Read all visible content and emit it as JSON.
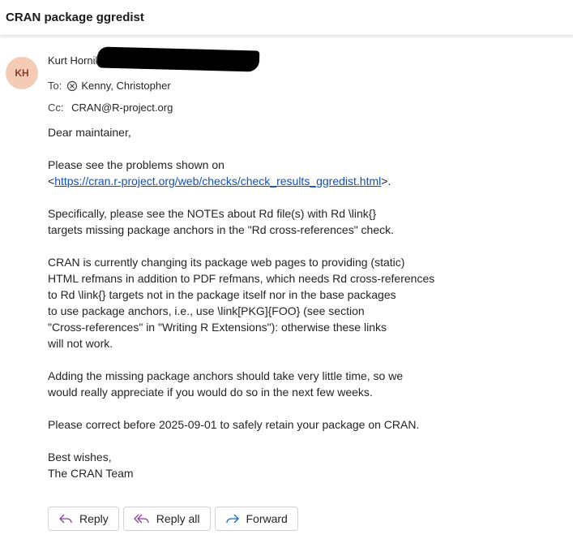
{
  "subject": "CRAN package ggredist",
  "sender": {
    "initials": "KH",
    "name_visible": "Kurt Hornik"
  },
  "recipients": {
    "to_label": "To:",
    "to_name": "Kenny, Christopher",
    "cc_label": "Cc:",
    "cc_value": "CRAN@R-project.org"
  },
  "body": {
    "greeting": "Dear maintainer,",
    "p1_a": "Please see the problems shown on\n<",
    "p1_link": "https://cran.r-project.org/web/checks/check_results_ggredist.html",
    "p1_b": ">.",
    "p2": "Specifically, please see the NOTEs about Rd file(s) with Rd \\link{}\ntargets missing package anchors in the \"Rd cross-references\" check.",
    "p3": "CRAN is currently changing its package web pages to providing (static)\nHTML refmans in addition to PDF refmans, which needs Rd cross-references\nto Rd \\link{} targets not in the package itself nor in the base packages\nto use package anchors, i.e., use \\link[PKG]{FOO} (see section\n\"Cross-references\" in \"Writing R Extensions\"): otherwise these links\nwill not work.",
    "p4": "Adding the missing package anchors should take very little time, so we\nwould really appreciate if you would do so in the next few weeks.",
    "p5": "Please correct before 2025-09-01 to safely retain your package on CRAN.",
    "signoff": "Best wishes,\nThe CRAN Team"
  },
  "actions": {
    "reply": "Reply",
    "reply_all": "Reply all",
    "forward": "Forward"
  },
  "colors": {
    "avatar_bg": "#f4cbb5",
    "avatar_fg": "#8a3d2a",
    "link": "#0f4fbf",
    "reply_icon": "#8a3d9a",
    "forward_icon": "#0f6cbd"
  }
}
